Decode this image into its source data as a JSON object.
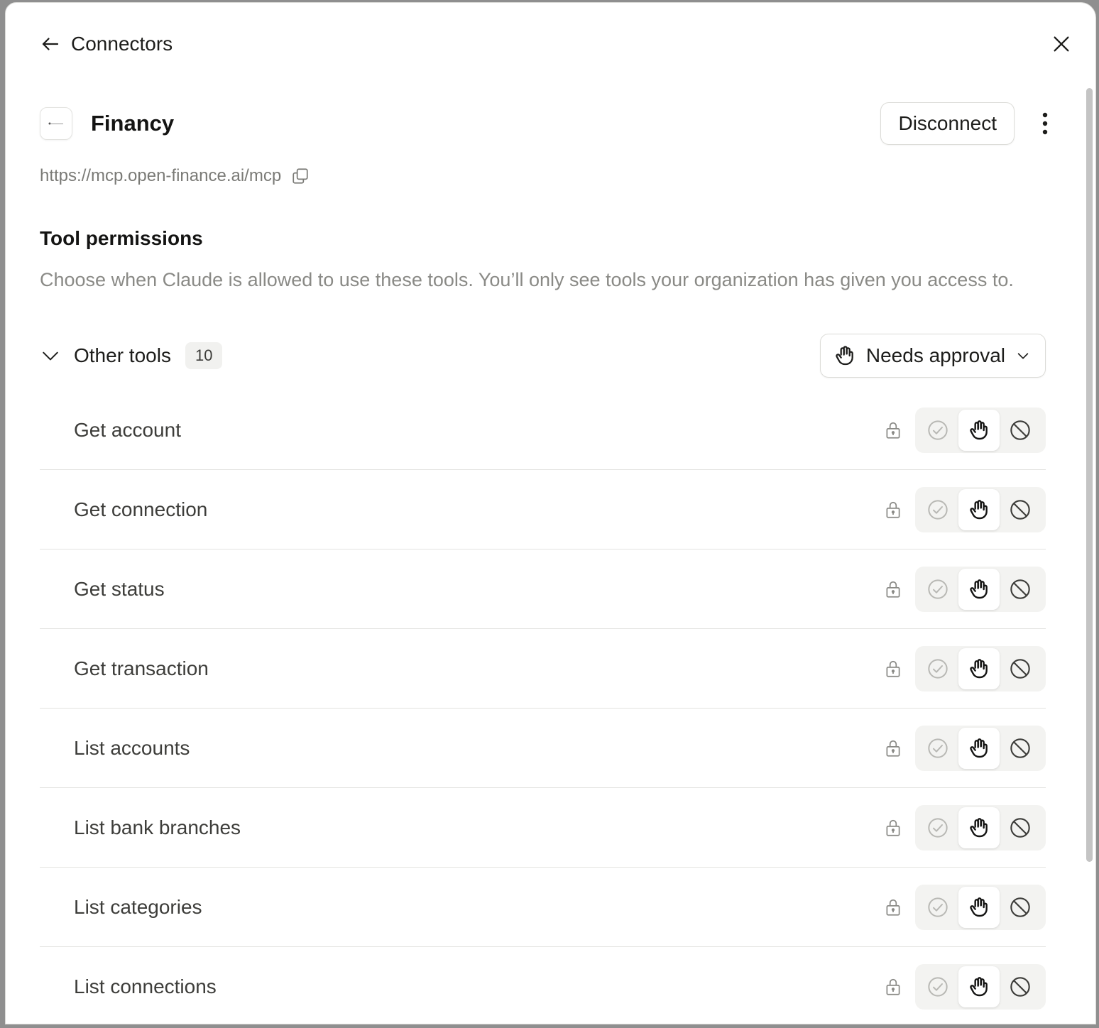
{
  "header": {
    "title": "Connectors",
    "back_icon": "arrow-left-icon",
    "close_icon": "close-icon"
  },
  "app": {
    "name": "Financy",
    "disconnect_label": "Disconnect",
    "url": "https://mcp.open-finance.ai/mcp"
  },
  "permissions": {
    "title": "Tool permissions",
    "description": "Choose when Claude is allowed to use these tools. You’ll only see tools your organization has given you access to."
  },
  "group": {
    "label": "Other tools",
    "count": "10",
    "approval_label": "Needs approval"
  },
  "tools": [
    {
      "name": "Get account",
      "permission": "needs-approval"
    },
    {
      "name": "Get connection",
      "permission": "needs-approval"
    },
    {
      "name": "Get status",
      "permission": "needs-approval"
    },
    {
      "name": "Get transaction",
      "permission": "needs-approval"
    },
    {
      "name": "List accounts",
      "permission": "needs-approval"
    },
    {
      "name": "List bank branches",
      "permission": "needs-approval"
    },
    {
      "name": "List categories",
      "permission": "needs-approval"
    },
    {
      "name": "List connections",
      "permission": "needs-approval"
    }
  ],
  "colors": {
    "text_primary": "#141413",
    "text_muted": "#8a8a86",
    "border": "#e3e3e0",
    "segment_bg": "#f3f3f1"
  }
}
